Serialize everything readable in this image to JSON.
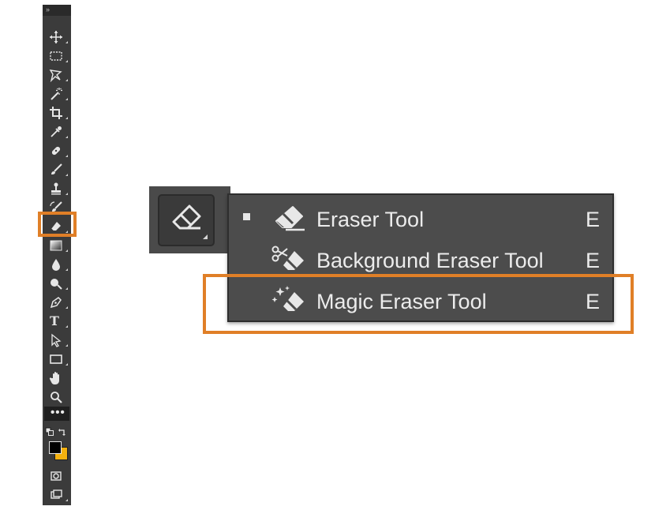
{
  "toolbar": {
    "collapse_glyph": "››",
    "tools": [
      {
        "name": "move-tool",
        "icon": "move-icon"
      },
      {
        "name": "marquee-tool",
        "icon": "rectangular-marquee-icon"
      },
      {
        "name": "lasso-tool",
        "icon": "polygonal-lasso-icon"
      },
      {
        "name": "magic-wand-tool",
        "icon": "magic-wand-icon"
      },
      {
        "name": "crop-tool",
        "icon": "crop-icon"
      },
      {
        "name": "eyedropper-tool",
        "icon": "eyedropper-icon"
      },
      {
        "name": "healing-brush-tool",
        "icon": "bandage-icon"
      },
      {
        "name": "brush-tool",
        "icon": "brush-icon"
      },
      {
        "name": "clone-stamp-tool",
        "icon": "stamp-icon"
      },
      {
        "name": "history-brush-tool",
        "icon": "history-brush-icon"
      },
      {
        "name": "eraser-tool",
        "icon": "eraser-icon",
        "selected": true
      },
      {
        "name": "gradient-tool",
        "icon": "gradient-icon"
      },
      {
        "name": "blur-tool",
        "icon": "drop-icon"
      },
      {
        "name": "dodge-tool",
        "icon": "dodge-icon"
      },
      {
        "name": "pen-tool",
        "icon": "pen-icon"
      },
      {
        "name": "type-tool",
        "icon": "type-icon"
      },
      {
        "name": "path-selection-tool",
        "icon": "arrow-icon"
      },
      {
        "name": "rectangle-tool",
        "icon": "rectangle-icon"
      },
      {
        "name": "hand-tool",
        "icon": "hand-icon"
      },
      {
        "name": "zoom-tool",
        "icon": "zoom-icon"
      }
    ],
    "type_tool_glyph": "T",
    "more_tools_glyph": "•••",
    "foreground_color": "#000000",
    "background_color": "#f4b10f"
  },
  "active_tool": {
    "icon": "eraser-icon"
  },
  "flyout_menu": {
    "items": [
      {
        "label": "Eraser Tool",
        "shortcut": "E",
        "icon": "eraser-icon",
        "checked": true
      },
      {
        "label": "Background Eraser Tool",
        "shortcut": "E",
        "icon": "background-eraser-icon",
        "checked": false
      },
      {
        "label": "Magic Eraser Tool",
        "shortcut": "E",
        "icon": "magic-eraser-icon",
        "checked": false
      }
    ]
  },
  "colors": {
    "highlight": "#e07f27",
    "toolbar_bg": "#3b3b3b",
    "menu_bg": "#4c4c4c",
    "text": "#ececec"
  }
}
